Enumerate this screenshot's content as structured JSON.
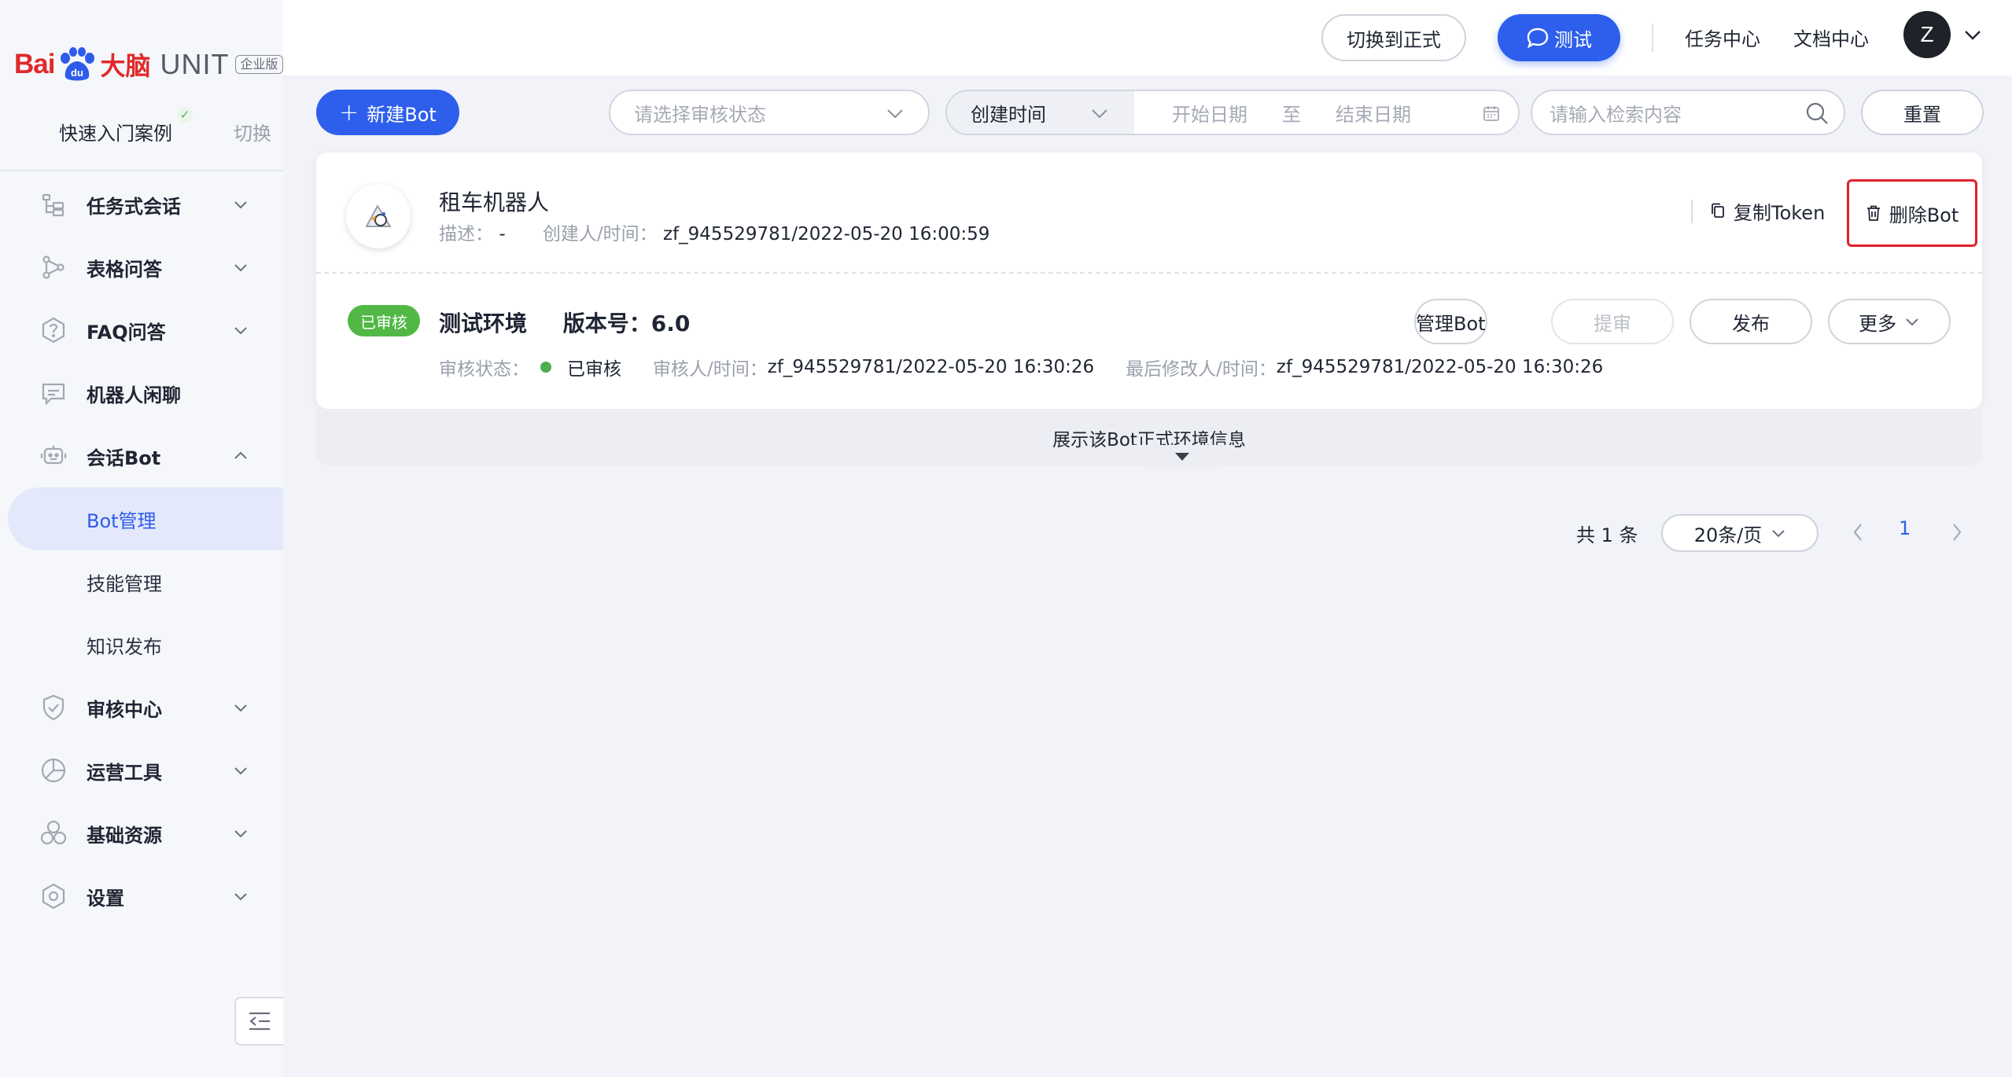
{
  "brand": {
    "bai": "Bai",
    "danao": "大脑",
    "unit": "UNIT",
    "edition": "企业版"
  },
  "quick": {
    "label": "快速入门案例",
    "switch_label": "切换"
  },
  "sidebar": {
    "items": [
      {
        "label": "任务式会话",
        "icon": "task-dialog-icon",
        "expanded": false
      },
      {
        "label": "表格问答",
        "icon": "table-qa-icon",
        "expanded": false
      },
      {
        "label": "FAQ问答",
        "icon": "faq-icon",
        "expanded": false
      },
      {
        "label": "机器人闲聊",
        "icon": "chat-bot-icon",
        "expanded": null
      },
      {
        "label": "会话Bot",
        "icon": "bot-icon",
        "expanded": true
      },
      {
        "label": "审核中心",
        "icon": "shield-icon",
        "expanded": false
      },
      {
        "label": "运营工具",
        "icon": "operations-icon",
        "expanded": false
      },
      {
        "label": "基础资源",
        "icon": "resources-icon",
        "expanded": false
      },
      {
        "label": "设置",
        "icon": "settings-icon",
        "expanded": false
      }
    ],
    "subitems": [
      {
        "label": "Bot管理",
        "active": true
      },
      {
        "label": "技能管理",
        "active": false
      },
      {
        "label": "知识发布",
        "active": false
      }
    ]
  },
  "header": {
    "switch_label": "切换到正式",
    "test_label": "测试",
    "task_center": "任务中心",
    "doc_center": "文档中心",
    "avatar_letter": "Z"
  },
  "toolbar": {
    "new_bot": "新建Bot",
    "status_placeholder": "请选择审核状态",
    "date_type": "创建时间",
    "start_date": "开始日期",
    "to": "至",
    "end_date": "结束日期",
    "search_placeholder": "请输入检索内容",
    "reset": "重置"
  },
  "bot": {
    "name": "租车机器人",
    "desc_label": "描述：",
    "desc_value": "-",
    "creator_label": "创建人/时间：",
    "creator_value": "zf_945529781/2022-05-20 16:00:59",
    "copy_token": "复制Token",
    "delete": "删除Bot"
  },
  "env": {
    "badge": "已审核",
    "title": "测试环境",
    "version_label": "版本号：",
    "version": "6.0",
    "status_label": "审核状态：",
    "status_value": "已审核",
    "reviewer_label": "审核人/时间：",
    "reviewer_value": "zf_945529781/2022-05-20 16:30:26",
    "modifier_label": "最后修改人/时间：",
    "modifier_value": "zf_945529781/2022-05-20 16:30:26",
    "btn_manage": "管理Bot",
    "btn_review": "提审",
    "btn_publish": "发布",
    "btn_more": "更多"
  },
  "expand": {
    "label": "展示该Bot正式环境信息"
  },
  "pagination": {
    "total": "共 1 条",
    "page_size": "20条/页",
    "current": "1"
  },
  "colors": {
    "primary": "#2e5fec",
    "success": "#52b845",
    "danger": "#e0202e"
  }
}
